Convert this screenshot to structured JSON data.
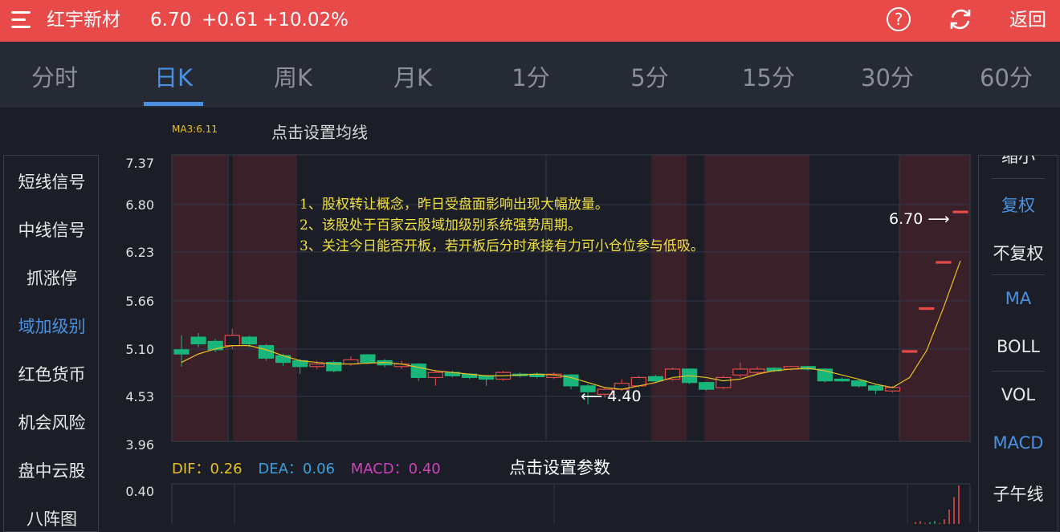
{
  "header": {
    "stock_name": "红宇新材",
    "price": "6.70",
    "change": "+0.61",
    "change_pct": "+10.02%",
    "back_label": "返回",
    "help_icon": "question-circle-icon",
    "refresh_icon": "refresh-icon",
    "menu_icon": "hamburger-menu-icon",
    "color": "#e84a4a"
  },
  "tabs": [
    "分时",
    "日K",
    "周K",
    "月K",
    "1分",
    "5分",
    "15分",
    "30分",
    "60分"
  ],
  "active_tab": "日K",
  "ma": {
    "label": "MA3:6.11",
    "set_label": "点击设置均线"
  },
  "left_menu": [
    "短线信号",
    "中线信号",
    "抓涨停",
    "域加级别",
    "红色货币",
    "机会风险",
    "盘中云股",
    "八阵图"
  ],
  "left_active": "域加级别",
  "right_menu": [
    "缩小",
    "复权",
    "不复权",
    "MA",
    "BOLL",
    "VOL",
    "MACD",
    "子午线"
  ],
  "right_blue": [
    "复权",
    "MA",
    "MACD"
  ],
  "annotations": [
    "1、股权转让概念，昨日受盘面影响出现大幅放量。",
    "2、该股处于百家云股域加级别系统强势周期。",
    "3、关注今日能否开板，若开板后分时承接有力可小仓位参与低吸。"
  ],
  "price_marker": "6.70",
  "low_marker": "4.40",
  "macd": {
    "dif_label": "DIF：0.26",
    "dea_label": "DEA：0.06",
    "macd_label": "MACD：0.40",
    "set_label": "点击设置参数",
    "top_value": "0.40"
  },
  "colors": {
    "up": "#e84a4a",
    "down": "#18b67a",
    "ma": "#e8c224",
    "dif": "#e8c224",
    "dea": "#3aa0e0",
    "macd": "#d040c0",
    "accent": "#4a90e2"
  },
  "chart_data": {
    "type": "candlestick",
    "y_ticks": [
      "7.37",
      "6.80",
      "6.23",
      "5.66",
      "5.10",
      "4.53",
      "3.96"
    ],
    "ylim": [
      3.96,
      7.37
    ],
    "candles": [
      [
        5.05,
        5.0,
        5.22,
        4.85
      ],
      [
        5.2,
        5.12,
        5.25,
        5.08
      ],
      [
        5.15,
        5.05,
        5.18,
        5.02
      ],
      [
        5.1,
        5.22,
        5.3,
        5.06
      ],
      [
        5.2,
        5.12,
        5.22,
        5.08
      ],
      [
        5.1,
        4.95,
        5.12,
        4.92
      ],
      [
        4.98,
        4.9,
        5.0,
        4.86
      ],
      [
        4.92,
        4.85,
        4.94,
        4.76
      ],
      [
        4.85,
        4.88,
        4.92,
        4.82
      ],
      [
        4.9,
        4.8,
        4.92,
        4.78
      ],
      [
        4.88,
        4.93,
        4.97,
        4.86
      ],
      [
        4.99,
        4.9,
        5.0,
        4.88
      ],
      [
        4.92,
        4.87,
        4.94,
        4.84
      ],
      [
        4.85,
        4.88,
        4.92,
        4.82
      ],
      [
        4.88,
        4.72,
        4.89,
        4.68
      ],
      [
        4.72,
        4.78,
        4.81,
        4.62
      ],
      [
        4.78,
        4.74,
        4.8,
        4.72
      ],
      [
        4.76,
        4.72,
        4.77,
        4.7
      ],
      [
        4.74,
        4.7,
        4.75,
        4.62
      ],
      [
        4.7,
        4.78,
        4.8,
        4.68
      ],
      [
        4.76,
        4.75,
        4.78,
        4.72
      ],
      [
        4.76,
        4.73,
        4.78,
        4.71
      ],
      [
        4.72,
        4.76,
        4.78,
        4.7
      ],
      [
        4.75,
        4.62,
        4.76,
        4.58
      ],
      [
        4.62,
        4.55,
        4.64,
        4.4
      ],
      [
        4.52,
        4.58,
        4.6,
        4.48
      ],
      [
        4.58,
        4.65,
        4.7,
        4.56
      ],
      [
        4.62,
        4.72,
        4.74,
        4.6
      ],
      [
        4.73,
        4.68,
        4.75,
        4.66
      ],
      [
        4.7,
        4.82,
        4.84,
        4.68
      ],
      [
        4.82,
        4.66,
        4.83,
        4.64
      ],
      [
        4.66,
        4.58,
        4.67,
        4.56
      ],
      [
        4.6,
        4.72,
        4.74,
        4.58
      ],
      [
        4.75,
        4.82,
        4.9,
        4.72
      ],
      [
        4.78,
        4.82,
        4.85,
        4.76
      ],
      [
        4.83,
        4.8,
        4.84,
        4.78
      ],
      [
        4.82,
        4.85,
        4.86,
        4.8
      ],
      [
        4.85,
        4.82,
        4.86,
        4.8
      ],
      [
        4.82,
        4.68,
        4.83,
        4.66
      ],
      [
        4.7,
        4.68,
        4.72,
        4.67
      ],
      [
        4.68,
        4.62,
        4.69,
        4.6
      ],
      [
        4.62,
        4.57,
        4.64,
        4.52
      ],
      [
        4.56,
        4.6,
        4.62,
        4.54
      ],
      [
        5.03,
        5.04,
        5.04,
        5.03
      ],
      [
        5.54,
        5.55,
        5.55,
        5.54
      ],
      [
        6.09,
        6.1,
        6.1,
        6.09
      ],
      [
        6.69,
        6.7,
        6.7,
        6.69
      ]
    ],
    "ma3": [
      4.9,
      5.0,
      5.06,
      5.1,
      5.1,
      5.05,
      4.98,
      4.92,
      4.9,
      4.88,
      4.88,
      4.89,
      4.9,
      4.88,
      4.84,
      4.8,
      4.78,
      4.76,
      4.74,
      4.74,
      4.75,
      4.76,
      4.75,
      4.72,
      4.66,
      4.6,
      4.58,
      4.62,
      4.66,
      4.72,
      4.74,
      4.72,
      4.68,
      4.7,
      4.76,
      4.8,
      4.82,
      4.83,
      4.8,
      4.75,
      4.7,
      4.64,
      4.6,
      4.72,
      5.04,
      5.55,
      6.11
    ],
    "macd_values": [
      0.02,
      0.03,
      0.01,
      -0.02,
      -0.03,
      0.01,
      0.05,
      0.15,
      0.28,
      0.4
    ]
  }
}
